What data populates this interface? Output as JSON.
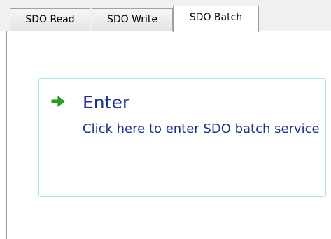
{
  "tabs": [
    {
      "label": "SDO Read",
      "active": false
    },
    {
      "label": "SDO Write",
      "active": false
    },
    {
      "label": "SDO Batch",
      "active": true
    }
  ],
  "command_link": {
    "icon": "green-arrow-right-icon",
    "title": "Enter",
    "description": "Click here to enter  SDO batch service"
  },
  "colors": {
    "link_text": "#1e3287",
    "link_border": "#a6e4ee",
    "arrow": "#22a822",
    "tabstrip_bg": "#f0f0f0"
  }
}
